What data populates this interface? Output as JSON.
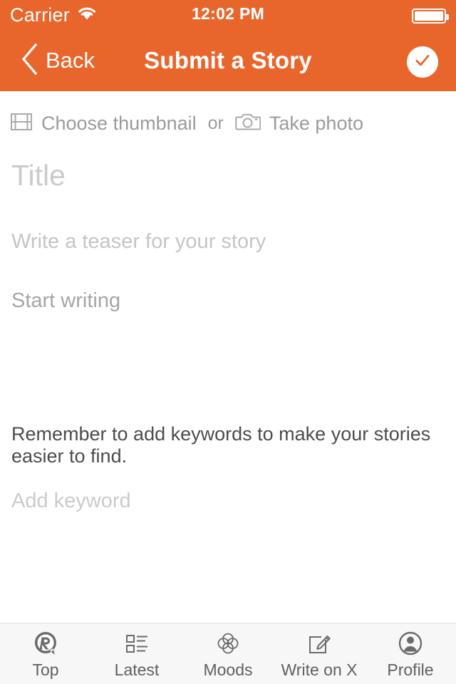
{
  "status_bar": {
    "carrier": "Carrier",
    "wifi_icon": "wifi-icon",
    "time": "12:02 PM",
    "battery_icon": "battery-full-icon"
  },
  "nav_bar": {
    "back_label": "Back",
    "back_icon": "chevron-left-icon",
    "title": "Submit a Story",
    "submit_icon": "checkmark-circle-icon"
  },
  "media": {
    "thumbnail_icon": "film-strip-icon",
    "thumbnail_label": "Choose thumbnail",
    "or_label": "or",
    "photo_icon": "camera-icon",
    "photo_label": "Take photo"
  },
  "form": {
    "title_placeholder": "Title",
    "teaser_placeholder": "Write a teaser for your story",
    "body_placeholder": "Start writing",
    "keyword_note": "Remember to add keywords to make your stories easier to find.",
    "keyword_placeholder": "Add keyword"
  },
  "tabs": [
    {
      "label": "Top",
      "icon": "r-badge-icon"
    },
    {
      "label": "Latest",
      "icon": "list-icon"
    },
    {
      "label": "Moods",
      "icon": "clover-icon"
    },
    {
      "label": "Write on X",
      "icon": "pencil-square-icon"
    },
    {
      "label": "Profile",
      "icon": "person-circle-icon"
    }
  ],
  "colors": {
    "accent": "#E8662C",
    "placeholder": "#c9cbcd",
    "body_text": "#4c4c4c",
    "tab_bar_bg": "#F7F7F7"
  }
}
